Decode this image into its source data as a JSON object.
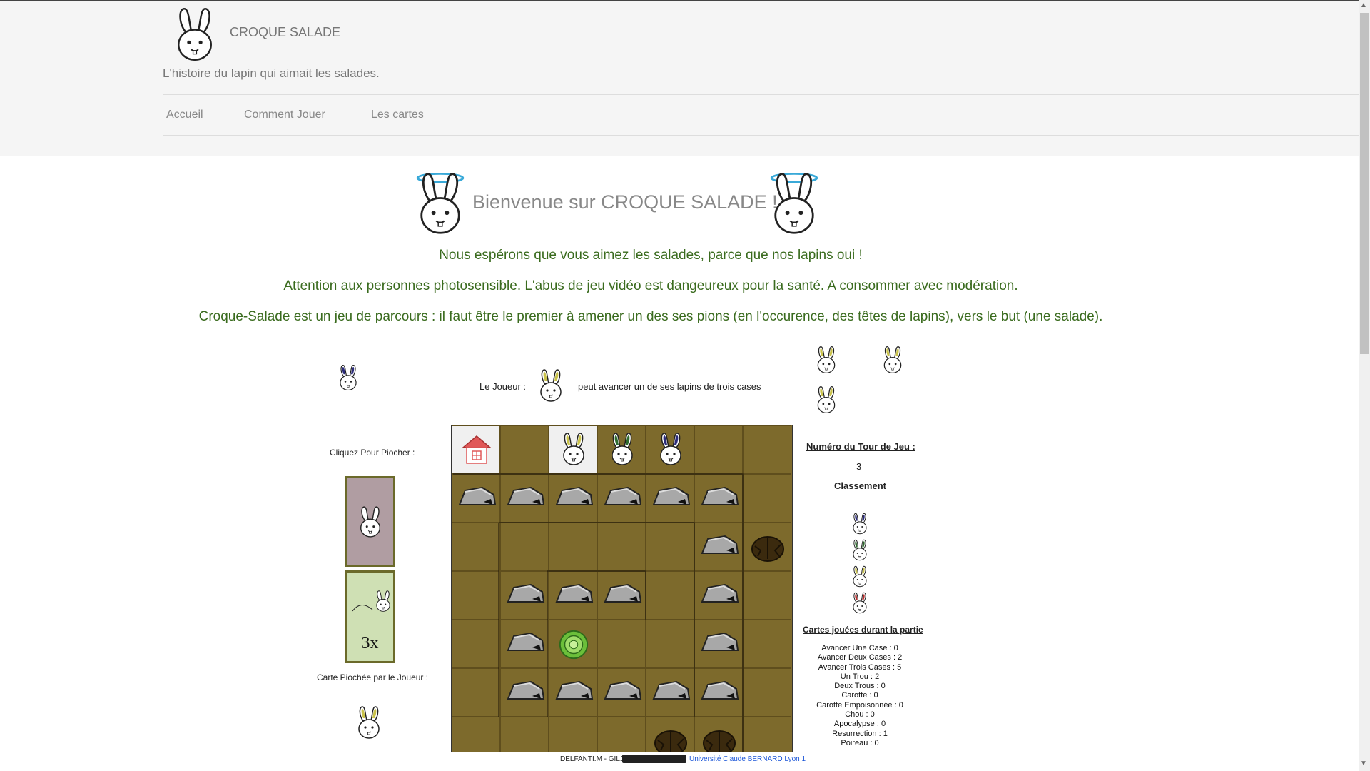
{
  "site": {
    "title": "CROQUE SALADE",
    "tagline": "L'histoire du lapin qui aimait les salades."
  },
  "nav": [
    {
      "label": "Accueil"
    },
    {
      "label": "Comment Jouer"
    },
    {
      "label": "Les cartes"
    }
  ],
  "welcome": "Bienvenue sur CROQUE SALADE !",
  "messages": [
    "Nous espérons que vous aimez les salades, parce que nos lapins oui !",
    "Attention aux personnes photosensible. L'abus de jeu vidéo est dangeureux pour la santé. A consommer avec modération.",
    "Croque-Salade est un jeu de parcours : il faut être le premier à amener un des ses pions (en l'occurence, des têtes de lapins), vers le but (une salade)."
  ],
  "game": {
    "player_prefix": "Le Joueur :",
    "player_action": "peut avancer un de ses lapins de trois cases",
    "current_player_color": "#c9c24a",
    "draw_label": "Cliquez Pour Piocher :",
    "drawn_label": "Carte Piochée par le Joueur :",
    "drawn_card_text": "3x",
    "turn_label": "Numéro du Tour de Jeu :",
    "turn_number": "3",
    "ranking_label": "Classement",
    "ranking_colors": [
      "#2b2b7a",
      "#2f6b2f",
      "#c9c24a",
      "#b82d2d"
    ],
    "cards_played_label": "Cartes jouées durant la partie",
    "cards_played": [
      "Avancer Une Case : 0",
      "Avancer Deux Cases : 2",
      "Avancer Trois Cases : 5",
      "Un Trou : 2",
      "Deux Trous : 0",
      "Carotte : 0",
      "Carotte Empoisonnée : 0",
      "Chou : 0",
      "Apocalypse : 0",
      "Resurrection : 1",
      "Poireau : 0"
    ]
  },
  "colors": {
    "green_text": "#3a6b1e",
    "soil": "#7d6a2c",
    "rock": "#a6a6a6"
  },
  "footer": {
    "authors": "DELFANTI.M - GILJ",
    "university": "Université Claude BERNARD Lyon 1"
  }
}
